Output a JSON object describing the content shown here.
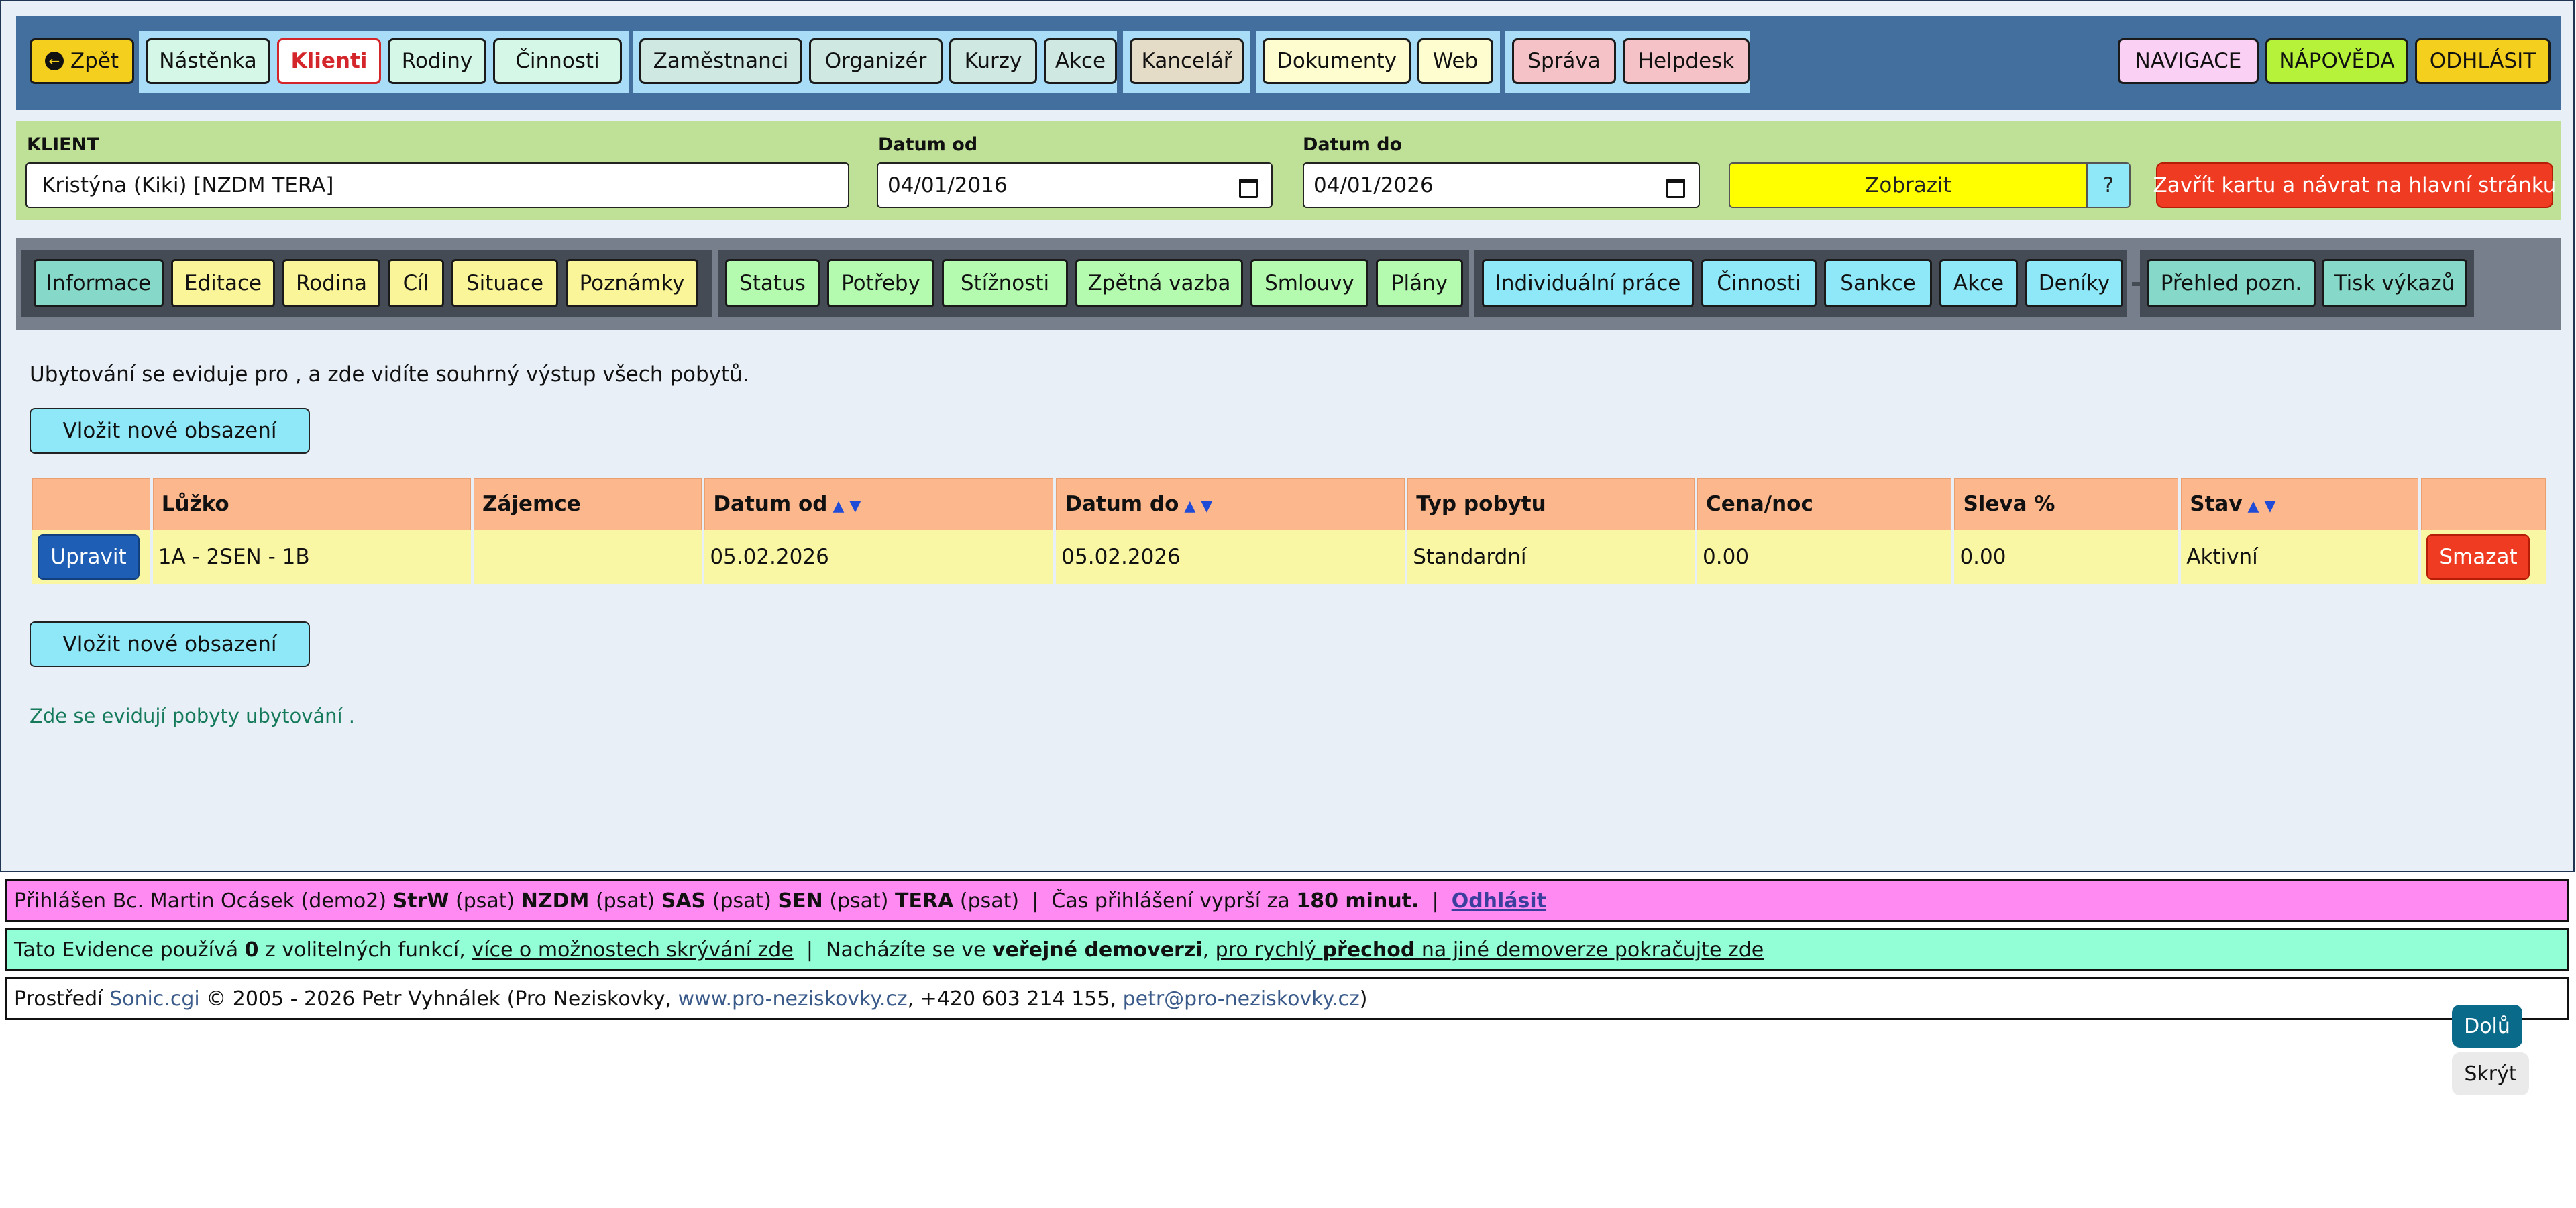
{
  "topnav": {
    "back": "Zpět",
    "g1": [
      "Nástěnka",
      "Klienti",
      "Rodiny",
      "Činnosti"
    ],
    "g2": [
      "Zaměstnanci",
      "Organizér",
      "Kurzy",
      "Akce"
    ],
    "g3": [
      "Kancelář"
    ],
    "g4": [
      "Dokumenty",
      "Web"
    ],
    "g5": [
      "Správa",
      "Helpdesk"
    ],
    "right": [
      "NAVIGACE",
      "NÁPOVĚDA",
      "ODHLÁSIT"
    ],
    "active": "Klienti"
  },
  "client": {
    "label": "KLIENT",
    "value": "Kristýna (Kiki) [NZDM TERA]",
    "date_from_label": "Datum od",
    "date_from": "04/01/2016",
    "date_to_label": "Datum do",
    "date_to": "04/01/2026",
    "show_label": "Zobrazit",
    "help_label": "?",
    "close_label": "Zavřít kartu a návrat na hlavní stránku"
  },
  "subnav": {
    "g1": [
      "Informace",
      "Editace",
      "Rodina",
      "Cíl",
      "Situace",
      "Poznámky"
    ],
    "g2": [
      "Status",
      "Potřeby",
      "Stížnosti",
      "Zpětná vazba",
      "Smlouvy",
      "Plány"
    ],
    "g3": [
      "Individuální práce",
      "Činnosti",
      "Sankce",
      "Akce",
      "Deníky"
    ],
    "g4": [
      "Přehled pozn.",
      "Tisk výkazů"
    ]
  },
  "content": {
    "intro": "Ubytování se eviduje pro , a zde vidíte souhrný výstup všech pobytů.",
    "add_label": "Vložit nové obsazení",
    "note": "Zde se evidují pobyty ubytování ."
  },
  "table": {
    "headers": [
      "",
      "Lůžko",
      "Zájemce",
      "Datum od",
      "Datum do",
      "Typ pobytu",
      "Cena/noc",
      "Sleva %",
      "Stav",
      ""
    ],
    "sort_asc": "▲",
    "sort_desc": "▼",
    "rows": [
      {
        "edit_label": "Upravit",
        "luzko": "1A - 2SEN - 1B",
        "zajemce": "",
        "datum_od": "05.02.2026",
        "datum_do": "05.02.2026",
        "typ": "Standardní",
        "cena": "0.00",
        "sleva": "0.00",
        "stav": "Aktivní",
        "delete_label": "Smazat"
      }
    ]
  },
  "footer": {
    "login": {
      "prefix": "Přihlášen Bc. Martin Ocásek (demo2)",
      "roles": [
        {
          "name": "StrW",
          "perm": "(psat)"
        },
        {
          "name": "NZDM",
          "perm": "(psat)"
        },
        {
          "name": "SAS",
          "perm": "(psat)"
        },
        {
          "name": "SEN",
          "perm": "(psat)"
        },
        {
          "name": "TERA",
          "perm": "(psat)"
        }
      ],
      "separator": "|",
      "expire_prefix": "Čas přihlášení vyprší za",
      "expire_value": "180 minut.",
      "logout": "Odhlásit"
    },
    "info": {
      "t1": "Tato Evidence používá",
      "count": "0",
      "t2": "z volitelných funkcí,",
      "link1": "více o možnostech skrývání zde",
      "t3": "Nacházíte se ve",
      "bold1": "veřejné demoverzi",
      "link2_a": "pro rychlý",
      "link2_b": "přechod",
      "link2_c": "na jiné demoverze pokračujte zde"
    },
    "copyright": {
      "t1": "Prostředí",
      "product": "Sonic.cgi",
      "t2": "© 2005 - 2026 Petr Vyhnálek (Pro Neziskovky,",
      "web": "www.pro-neziskovky.cz",
      "t3": ", +420 603 214 155,",
      "email": "petr@pro-neziskovky.cz",
      "t4": ")"
    }
  },
  "side": {
    "down": "Dolů",
    "hide": "Skrýt"
  },
  "colors": {
    "topnav_bg": "#436f9e",
    "client_bar": "#bfe197",
    "table_header": "#fdb78d",
    "table_row": "#f9f7a3",
    "danger": "#ee3b22",
    "accent_blue": "#1e5fb5"
  },
  "icons": {
    "back": "circle-arrow-left-icon",
    "calendar": "calendar-icon",
    "sort": "sort-arrows-icon"
  }
}
